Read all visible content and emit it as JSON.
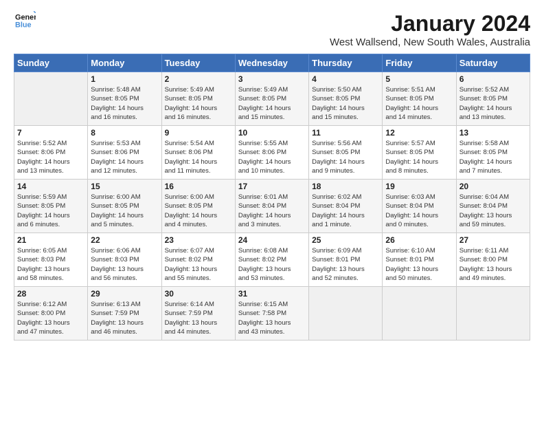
{
  "logo": {
    "line1": "General",
    "line2": "Blue"
  },
  "title": "January 2024",
  "location": "West Wallsend, New South Wales, Australia",
  "days_of_week": [
    "Sunday",
    "Monday",
    "Tuesday",
    "Wednesday",
    "Thursday",
    "Friday",
    "Saturday"
  ],
  "weeks": [
    [
      {
        "num": "",
        "info": ""
      },
      {
        "num": "1",
        "info": "Sunrise: 5:48 AM\nSunset: 8:05 PM\nDaylight: 14 hours\nand 16 minutes."
      },
      {
        "num": "2",
        "info": "Sunrise: 5:49 AM\nSunset: 8:05 PM\nDaylight: 14 hours\nand 16 minutes."
      },
      {
        "num": "3",
        "info": "Sunrise: 5:49 AM\nSunset: 8:05 PM\nDaylight: 14 hours\nand 15 minutes."
      },
      {
        "num": "4",
        "info": "Sunrise: 5:50 AM\nSunset: 8:05 PM\nDaylight: 14 hours\nand 15 minutes."
      },
      {
        "num": "5",
        "info": "Sunrise: 5:51 AM\nSunset: 8:05 PM\nDaylight: 14 hours\nand 14 minutes."
      },
      {
        "num": "6",
        "info": "Sunrise: 5:52 AM\nSunset: 8:05 PM\nDaylight: 14 hours\nand 13 minutes."
      }
    ],
    [
      {
        "num": "7",
        "info": "Sunrise: 5:52 AM\nSunset: 8:06 PM\nDaylight: 14 hours\nand 13 minutes."
      },
      {
        "num": "8",
        "info": "Sunrise: 5:53 AM\nSunset: 8:06 PM\nDaylight: 14 hours\nand 12 minutes."
      },
      {
        "num": "9",
        "info": "Sunrise: 5:54 AM\nSunset: 8:06 PM\nDaylight: 14 hours\nand 11 minutes."
      },
      {
        "num": "10",
        "info": "Sunrise: 5:55 AM\nSunset: 8:06 PM\nDaylight: 14 hours\nand 10 minutes."
      },
      {
        "num": "11",
        "info": "Sunrise: 5:56 AM\nSunset: 8:05 PM\nDaylight: 14 hours\nand 9 minutes."
      },
      {
        "num": "12",
        "info": "Sunrise: 5:57 AM\nSunset: 8:05 PM\nDaylight: 14 hours\nand 8 minutes."
      },
      {
        "num": "13",
        "info": "Sunrise: 5:58 AM\nSunset: 8:05 PM\nDaylight: 14 hours\nand 7 minutes."
      }
    ],
    [
      {
        "num": "14",
        "info": "Sunrise: 5:59 AM\nSunset: 8:05 PM\nDaylight: 14 hours\nand 6 minutes."
      },
      {
        "num": "15",
        "info": "Sunrise: 6:00 AM\nSunset: 8:05 PM\nDaylight: 14 hours\nand 5 minutes."
      },
      {
        "num": "16",
        "info": "Sunrise: 6:00 AM\nSunset: 8:05 PM\nDaylight: 14 hours\nand 4 minutes."
      },
      {
        "num": "17",
        "info": "Sunrise: 6:01 AM\nSunset: 8:04 PM\nDaylight: 14 hours\nand 3 minutes."
      },
      {
        "num": "18",
        "info": "Sunrise: 6:02 AM\nSunset: 8:04 PM\nDaylight: 14 hours\nand 1 minute."
      },
      {
        "num": "19",
        "info": "Sunrise: 6:03 AM\nSunset: 8:04 PM\nDaylight: 14 hours\nand 0 minutes."
      },
      {
        "num": "20",
        "info": "Sunrise: 6:04 AM\nSunset: 8:04 PM\nDaylight: 13 hours\nand 59 minutes."
      }
    ],
    [
      {
        "num": "21",
        "info": "Sunrise: 6:05 AM\nSunset: 8:03 PM\nDaylight: 13 hours\nand 58 minutes."
      },
      {
        "num": "22",
        "info": "Sunrise: 6:06 AM\nSunset: 8:03 PM\nDaylight: 13 hours\nand 56 minutes."
      },
      {
        "num": "23",
        "info": "Sunrise: 6:07 AM\nSunset: 8:02 PM\nDaylight: 13 hours\nand 55 minutes."
      },
      {
        "num": "24",
        "info": "Sunrise: 6:08 AM\nSunset: 8:02 PM\nDaylight: 13 hours\nand 53 minutes."
      },
      {
        "num": "25",
        "info": "Sunrise: 6:09 AM\nSunset: 8:01 PM\nDaylight: 13 hours\nand 52 minutes."
      },
      {
        "num": "26",
        "info": "Sunrise: 6:10 AM\nSunset: 8:01 PM\nDaylight: 13 hours\nand 50 minutes."
      },
      {
        "num": "27",
        "info": "Sunrise: 6:11 AM\nSunset: 8:00 PM\nDaylight: 13 hours\nand 49 minutes."
      }
    ],
    [
      {
        "num": "28",
        "info": "Sunrise: 6:12 AM\nSunset: 8:00 PM\nDaylight: 13 hours\nand 47 minutes."
      },
      {
        "num": "29",
        "info": "Sunrise: 6:13 AM\nSunset: 7:59 PM\nDaylight: 13 hours\nand 46 minutes."
      },
      {
        "num": "30",
        "info": "Sunrise: 6:14 AM\nSunset: 7:59 PM\nDaylight: 13 hours\nand 44 minutes."
      },
      {
        "num": "31",
        "info": "Sunrise: 6:15 AM\nSunset: 7:58 PM\nDaylight: 13 hours\nand 43 minutes."
      },
      {
        "num": "",
        "info": ""
      },
      {
        "num": "",
        "info": ""
      },
      {
        "num": "",
        "info": ""
      }
    ]
  ]
}
